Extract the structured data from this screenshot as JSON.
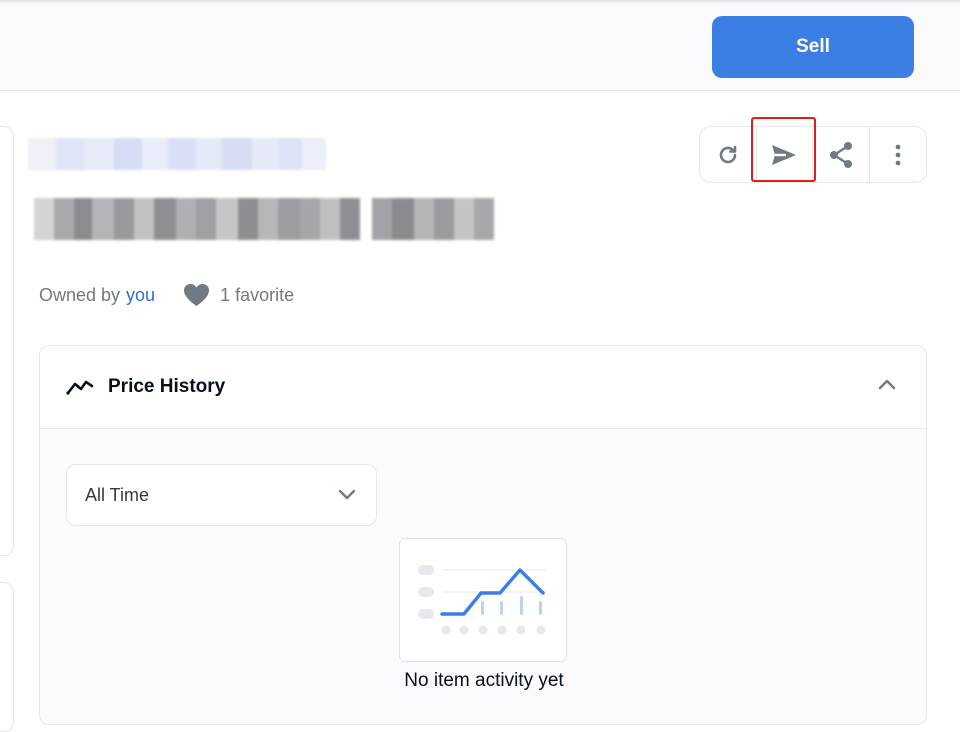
{
  "header": {
    "sell_label": "Sell"
  },
  "actions": [
    {
      "icon": "refresh-icon"
    },
    {
      "icon": "send-icon"
    },
    {
      "icon": "share-icon"
    },
    {
      "icon": "more-icon"
    }
  ],
  "owner": {
    "prefix": "Owned by",
    "owner_name": "you",
    "favorites": "1 favorite"
  },
  "price_history": {
    "title": "Price History",
    "range_selected": "All Time",
    "empty_message": "No item activity yet"
  },
  "colors": {
    "accent": "#3b7fe4",
    "highlight": "#e01c1c",
    "link": "#2f6fd1"
  }
}
